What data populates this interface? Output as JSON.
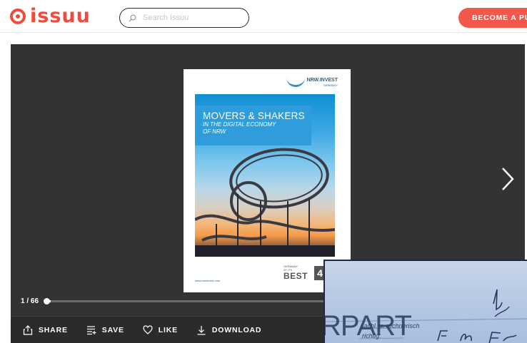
{
  "header": {
    "logo_text": "issuu",
    "search_placeholder": "Search Issuu",
    "cta_label": "BECOME A PUBLISHER"
  },
  "publication": {
    "publisher": "NRW.INVEST",
    "publisher_sub": "GERMANY",
    "title": "MOVERS & SHAKERS",
    "subtitle_line1": "IN THE DIGITAL ECONOMY",
    "subtitle_line2": "OF NRW",
    "url": "www.nrwinvest.com",
    "award_small_1": "GERMANY",
    "award_small_2": "AT ITS",
    "award_big": "BEST",
    "award_badge": "4"
  },
  "reader": {
    "current_page": 1,
    "total_pages": 66,
    "page_indicator": "1 / 66",
    "progress_fraction": 0.015
  },
  "toolbar": {
    "share": "SHARE",
    "save": "SAVE",
    "like": "LIKE",
    "download": "DOWNLOAD"
  },
  "overlay": {
    "big_text": "RPART",
    "handwritten_1": "sachl. u. rechnerisch",
    "handwritten_2": "richtig:"
  },
  "colors": {
    "brand": "#f04b3f",
    "cta": "#f0584c",
    "reader_bg": "#333333",
    "toolbar_bg": "#2b2b2b",
    "cover_title_box": "#2f9ddc"
  },
  "icons": [
    "issuu-logo-icon",
    "search-icon",
    "chevron-right-icon",
    "share-icon",
    "save-icon",
    "heart-icon",
    "download-icon"
  ]
}
